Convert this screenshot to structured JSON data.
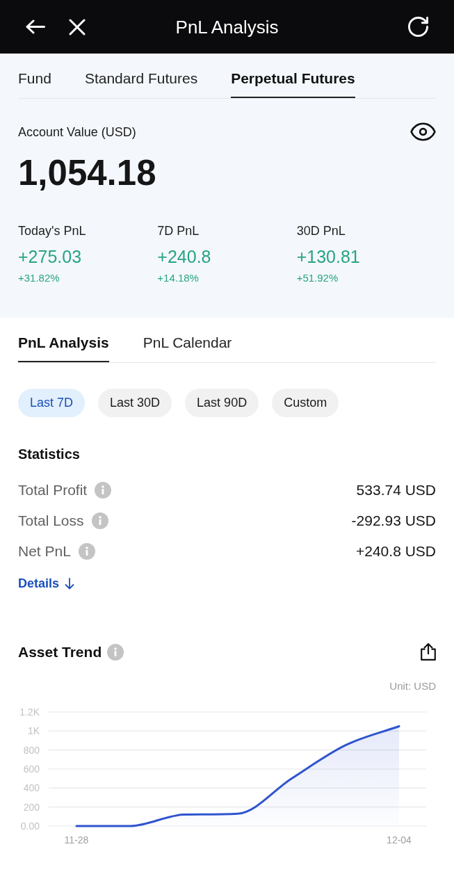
{
  "header": {
    "title": "PnL Analysis"
  },
  "account_tabs": [
    {
      "label": "Fund",
      "selected": false
    },
    {
      "label": "Standard Futures",
      "selected": false
    },
    {
      "label": "Perpetual Futures",
      "selected": true
    }
  ],
  "account": {
    "label": "Account Value (USD)",
    "value": "1,054.18",
    "pnl": [
      {
        "label": "Today's PnL",
        "value": "+275.03",
        "percent": "+31.82%"
      },
      {
        "label": "7D PnL",
        "value": "+240.8",
        "percent": "+14.18%"
      },
      {
        "label": "30D PnL",
        "value": "+130.81",
        "percent": "+51.92%"
      }
    ]
  },
  "analysis_tabs": [
    {
      "label": "PnL Analysis",
      "selected": true
    },
    {
      "label": "PnL Calendar",
      "selected": false
    }
  ],
  "periods": [
    {
      "label": "Last 7D",
      "selected": true
    },
    {
      "label": "Last 30D",
      "selected": false
    },
    {
      "label": "Last 90D",
      "selected": false
    },
    {
      "label": "Custom",
      "selected": false
    }
  ],
  "statistics": {
    "title": "Statistics",
    "rows": [
      {
        "label": "Total Profit",
        "value": "533.74 USD"
      },
      {
        "label": "Total Loss",
        "value": "-292.93 USD"
      },
      {
        "label": "Net PnL",
        "value": "+240.8 USD"
      }
    ],
    "details_link": "Details"
  },
  "asset_trend": {
    "title": "Asset Trend",
    "unit": "Unit: USD",
    "chart_data": {
      "type": "area",
      "categories": [
        "11-28",
        null,
        null,
        null,
        null,
        null,
        "12-04"
      ],
      "values": [
        0,
        0,
        120,
        130,
        500,
        850,
        1050
      ],
      "ylim": [
        0,
        1200
      ],
      "yticks": [
        {
          "value": 0,
          "label": "0.00"
        },
        200,
        400,
        600,
        800,
        {
          "value": 1000,
          "label": "1K"
        },
        {
          "value": 1200,
          "label": "1.2K"
        }
      ],
      "grid": true
    }
  }
}
